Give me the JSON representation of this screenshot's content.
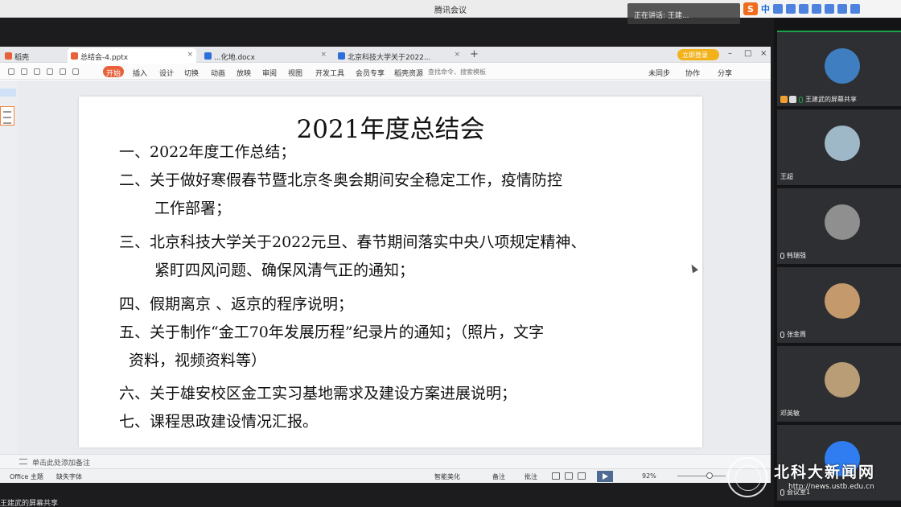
{
  "meeting": {
    "title": "腾讯会议",
    "speaking": "正在讲话: 王建..."
  },
  "ime": {
    "label": "中"
  },
  "tabs": [
    {
      "label": "稻壳",
      "color": "#e8613a"
    },
    {
      "label": "总结会-4.pptx",
      "color": "#e8613a"
    },
    {
      "label": "...化地.docx",
      "color": "#2f6fdb"
    },
    {
      "label": "北京科技大学关于2022...",
      "color": "#2f6fdb"
    }
  ],
  "login_label": "立即登录",
  "ribbon": {
    "menus": [
      "开始",
      "插入",
      "设计",
      "切换",
      "动画",
      "放映",
      "审阅",
      "视图",
      "开发工具",
      "会员专享",
      "稻壳资源"
    ],
    "search": "查找命令、搜索模板",
    "right": [
      "未同步",
      "协作",
      "分享"
    ]
  },
  "slide": {
    "title": "2021年度总结会",
    "lines": [
      "一、2022年度工作总结；",
      "二、关于做好寒假春节暨北京冬奥会期间安全稳定工作，疫情防控",
      "工作部署；",
      "三、北京科技大学关于2022元旦、春节期间落实中央八项规定精神、",
      "紧盯四风问题、确保风清气正的通知；",
      "四、假期离京 、返京的程序说明；",
      "五、关于制作“金工70年发展历程”纪录片的通知；（照片，文字",
      "资料，视频资料等）",
      "六、关于雄安校区金工实习基地需求及建设方案进展说明；",
      "七、课程思政建设情况汇报。"
    ]
  },
  "notes_placeholder": "单击此处添加备注",
  "status": {
    "theme": "Office 主题",
    "font": "缺失字体",
    "smart": "智能美化",
    "notes": "备注",
    "comments": "批注",
    "zoom": "92%"
  },
  "share_label": "王建武的屏幕共享",
  "participants": [
    {
      "name": "王建武的屏幕共享",
      "avatar_bg": "#3f7fc1"
    },
    {
      "name": "王超",
      "avatar_bg": "#9fb8c8"
    },
    {
      "name": "韩瑞强",
      "avatar_bg": "#8f8f8f"
    },
    {
      "name": "张金周",
      "avatar_bg": "#c49a6c"
    },
    {
      "name": "邓英敏",
      "avatar_bg": "#b89d76"
    },
    {
      "name": "会议室1",
      "avatar_bg": "#2f7df0"
    }
  ],
  "watermark": {
    "text": "北科大新闻网",
    "url": "http://news.ustb.edu.cn"
  }
}
